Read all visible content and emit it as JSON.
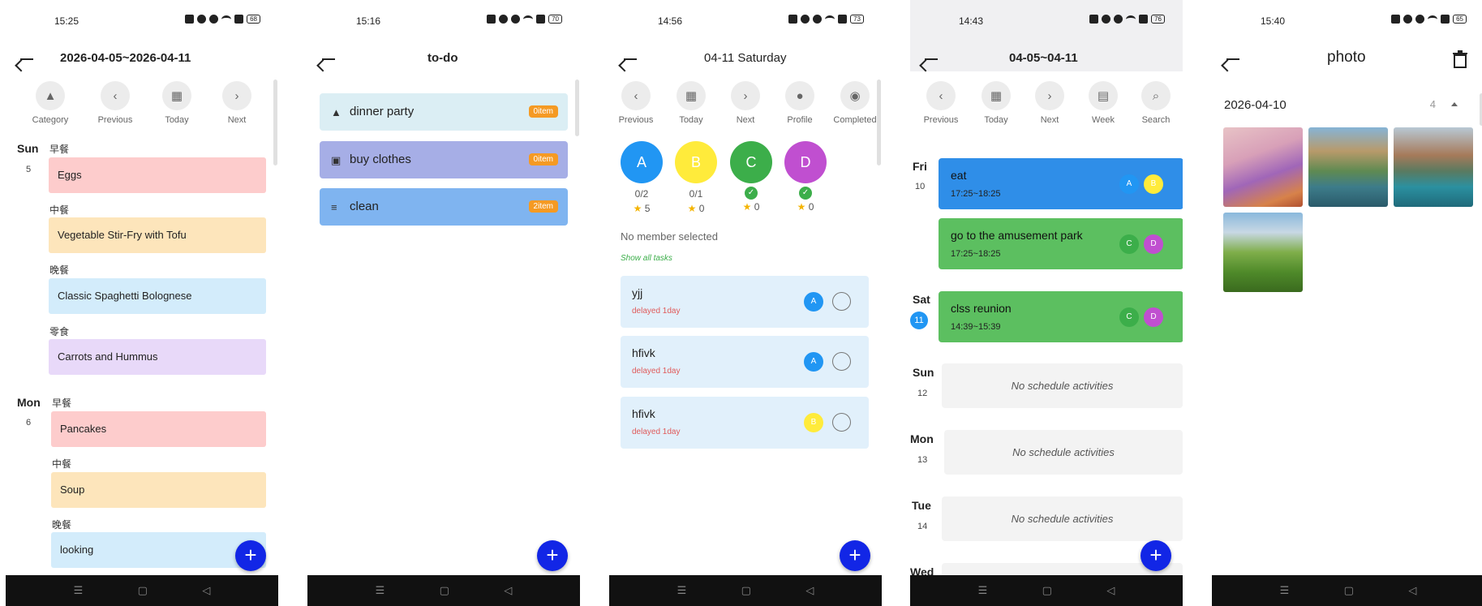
{
  "status_icons": [
    "nfc-icon",
    "moon-icon",
    "alarm-icon",
    "wifi-icon",
    "sim-icon",
    "battery-icon"
  ],
  "screens": [
    {
      "time": "15:25",
      "battery": "68",
      "title": "2026-04-05~2026-04-11",
      "toolbar": [
        {
          "icon": "category-icon",
          "label": "Category"
        },
        {
          "icon": "chevron-left-icon",
          "label": "Previous"
        },
        {
          "icon": "calendar-icon",
          "label": "Today"
        },
        {
          "icon": "chevron-right-icon",
          "label": "Next"
        }
      ],
      "days": [
        {
          "day": "Sun",
          "num": "5",
          "meals": [
            {
              "label": "早餐",
              "item": "Eggs"
            },
            {
              "label": "中餐",
              "item": "Vegetable Stir-Fry with Tofu"
            },
            {
              "label": "晚餐",
              "item": "Classic Spaghetti Bolognese"
            },
            {
              "label": "零食",
              "item": "Carrots and Hummus"
            }
          ]
        },
        {
          "day": "Mon",
          "num": "6",
          "meals": [
            {
              "label": "早餐",
              "item": "Pancakes"
            },
            {
              "label": "中餐",
              "item": "Soup"
            },
            {
              "label": "晚餐",
              "item": "looking"
            }
          ]
        }
      ],
      "fab": "+"
    },
    {
      "time": "15:16",
      "battery": "70",
      "title": "to-do",
      "items": [
        {
          "label": "dinner party",
          "badge": "0item",
          "color": "#dbeef4"
        },
        {
          "label": "buy clothes",
          "badge": "0item",
          "color": "#a6aee6"
        },
        {
          "label": "clean",
          "badge": "2item",
          "color": "#7fb4f0"
        }
      ],
      "fab": "+"
    },
    {
      "time": "14:56",
      "battery": "73",
      "title": "04-11 Saturday",
      "toolbar": [
        {
          "icon": "chevron-left-icon",
          "label": "Previous"
        },
        {
          "icon": "calendar-icon",
          "label": "Today"
        },
        {
          "icon": "chevron-right-icon",
          "label": "Next"
        },
        {
          "icon": "person-icon",
          "label": "Profile"
        },
        {
          "icon": "eye-icon",
          "label": "Completed"
        }
      ],
      "members": [
        {
          "letter": "A",
          "color": "#2196f3",
          "progress": "0/2",
          "stars": "5",
          "done": false
        },
        {
          "letter": "B",
          "color": "#ffeb3b",
          "progress": "0/1",
          "stars": "0",
          "done": false
        },
        {
          "letter": "C",
          "color": "#3cae4a",
          "progress": "",
          "stars": "0",
          "done": true
        },
        {
          "letter": "D",
          "color": "#c04fd0",
          "progress": "",
          "stars": "0",
          "done": true
        }
      ],
      "no_member": "No member selected",
      "show_all": "Show all tasks",
      "tasks": [
        {
          "title": "yjj",
          "sub": "delayed 1day",
          "member": "A",
          "color": "#2196f3"
        },
        {
          "title": "hfivk",
          "sub": "delayed 1day",
          "member": "A",
          "color": "#2196f3"
        },
        {
          "title": "hfivk",
          "sub": "delayed 1day",
          "member": "B",
          "color": "#ffeb3b"
        }
      ],
      "fab": "+"
    },
    {
      "time": "14:43",
      "battery": "76",
      "title": "04-05~04-11",
      "toolbar": [
        {
          "icon": "chevron-left-icon",
          "label": "Previous"
        },
        {
          "icon": "calendar-icon",
          "label": "Today"
        },
        {
          "icon": "chevron-right-icon",
          "label": "Next"
        },
        {
          "icon": "week-calendar-icon",
          "label": "Week"
        },
        {
          "icon": "search-icon",
          "label": "Search"
        }
      ],
      "fri": {
        "day": "Fri",
        "num": "10"
      },
      "events_fri": [
        {
          "title": "eat",
          "time": "17:25~18:25",
          "color": "#2f8ee8",
          "members": [
            {
              "l": "A",
              "c": "#2196f3"
            },
            {
              "l": "B",
              "c": "#ffeb3b"
            }
          ]
        },
        {
          "title": "go to the amusement park",
          "time": "17:25~18:25",
          "color": "#5cbf60",
          "members": [
            {
              "l": "C",
              "c": "#3cae4a"
            },
            {
              "l": "D",
              "c": "#c04fd0"
            }
          ]
        }
      ],
      "sat": {
        "day": "Sat",
        "num": "11"
      },
      "events_sat": [
        {
          "title": "clss reunion",
          "time": "14:39~15:39",
          "color": "#5cbf60",
          "members": [
            {
              "l": "C",
              "c": "#3cae4a"
            },
            {
              "l": "D",
              "c": "#c04fd0"
            }
          ]
        }
      ],
      "empty_days": [
        {
          "day": "Sun",
          "num": "12"
        },
        {
          "day": "Mon",
          "num": "13"
        },
        {
          "day": "Tue",
          "num": "14"
        }
      ],
      "empty_text": "No schedule activities",
      "partial_day": "Wed",
      "fab": "+"
    },
    {
      "time": "15:40",
      "battery": "65",
      "title": "photo",
      "album_date": "2026-04-10",
      "album_count": "4",
      "photos": [
        "flower-meadow-photo",
        "mountain-lake-photo",
        "valley-lake-photo",
        "green-hills-photo"
      ]
    }
  ],
  "nav": [
    "menu-icon",
    "home-square-icon",
    "back-triangle-icon"
  ]
}
